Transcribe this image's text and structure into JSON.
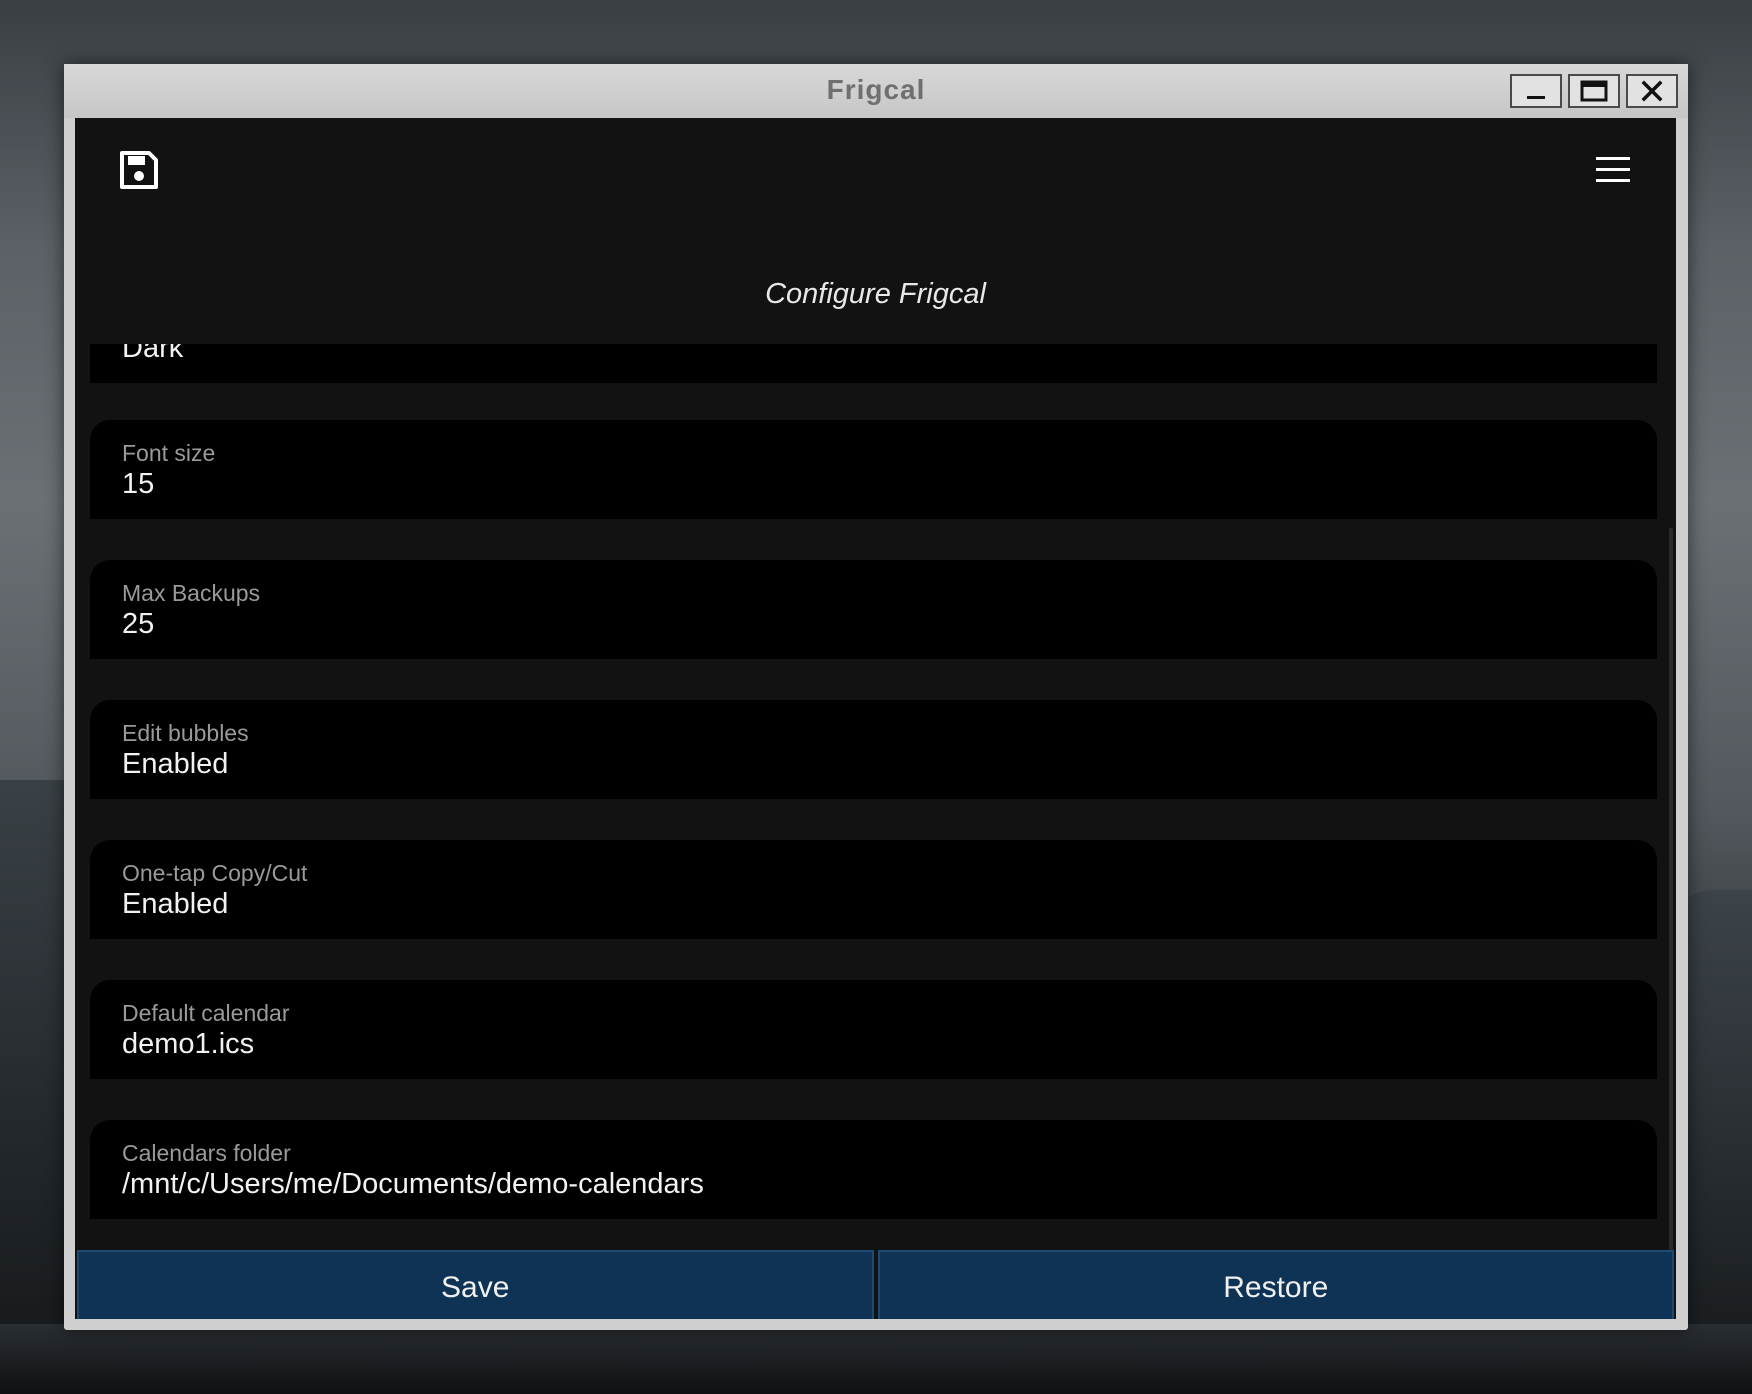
{
  "window": {
    "title": "Frigcal"
  },
  "header": {
    "page_title": "Configure Frigcal"
  },
  "settings": [
    {
      "label": "",
      "value": "Dark"
    },
    {
      "label": "Font size",
      "value": "15"
    },
    {
      "label": "Max Backups",
      "value": "25"
    },
    {
      "label": "Edit bubbles",
      "value": "Enabled"
    },
    {
      "label": "One-tap Copy/Cut",
      "value": "Enabled"
    },
    {
      "label": "Default calendar",
      "value": "demo1.ics"
    },
    {
      "label": "Calendars folder",
      "value": "/mnt/c/Users/me/Documents/demo-calendars"
    }
  ],
  "actions": {
    "save_label": "Save",
    "restore_label": "Restore"
  },
  "colors": {
    "background": "#121212",
    "field_background": "#000000",
    "button_background": "#0e3355",
    "label_text": "#9a9a9a",
    "value_text": "#f2f2f2"
  },
  "icons": {
    "save": "floppy-disk-icon",
    "menu": "hamburger-menu-icon"
  }
}
